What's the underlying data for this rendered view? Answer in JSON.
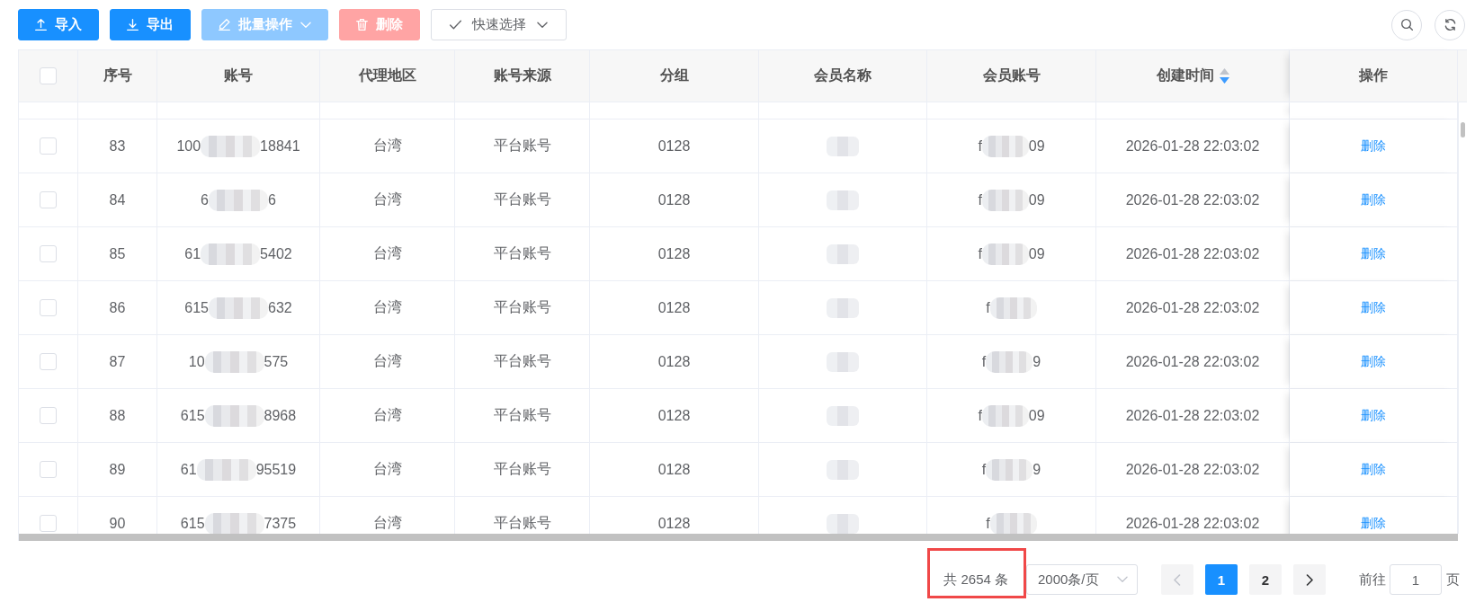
{
  "toolbar": {
    "buttons": [
      {
        "label": "导入",
        "kind": "import",
        "disabled": false,
        "dropdown": false
      },
      {
        "label": "导出",
        "kind": "export",
        "disabled": false,
        "dropdown": false
      },
      {
        "label": "批量操作",
        "kind": "batch",
        "disabled": true,
        "dropdown": true
      },
      {
        "label": "删除",
        "kind": "delete",
        "disabled": true,
        "dropdown": false
      },
      {
        "label": "快速选择",
        "kind": "quick_select",
        "disabled": false,
        "dropdown": true
      }
    ],
    "tools": [
      {
        "kind": "search"
      },
      {
        "kind": "refresh"
      }
    ]
  },
  "table": {
    "select_all": {
      "checked": false
    },
    "columns": [
      {
        "label": "序号"
      },
      {
        "label": "账号"
      },
      {
        "label": "代理地区"
      },
      {
        "label": "账号来源"
      },
      {
        "label": "分组"
      },
      {
        "label": "会员名称"
      },
      {
        "label": "会员账号"
      },
      {
        "label": "创建时间",
        "sort_descending": true
      },
      {
        "label": "操作"
      }
    ],
    "rows": [
      {
        "checked": false,
        "index": "83",
        "account": {
          "prefix": "100",
          "suffix": "18841"
        },
        "region": "台湾",
        "source": "平台账号",
        "group": "0128",
        "member_name": {
          "blurred": true
        },
        "member_account": {
          "prefix": "f",
          "suffix": "09"
        },
        "created": "2026-01-28 22:03:02",
        "action": "删除"
      },
      {
        "checked": false,
        "index": "84",
        "account": {
          "prefix": "6",
          "suffix": "6"
        },
        "region": "台湾",
        "source": "平台账号",
        "group": "0128",
        "member_name": {
          "blurred": true
        },
        "member_account": {
          "prefix": "f",
          "suffix": "09"
        },
        "created": "2026-01-28 22:03:02",
        "action": "删除"
      },
      {
        "checked": false,
        "index": "85",
        "account": {
          "prefix": "61",
          "suffix": "5402"
        },
        "region": "台湾",
        "source": "平台账号",
        "group": "0128",
        "member_name": {
          "blurred": true
        },
        "member_account": {
          "prefix": "f",
          "suffix": "09"
        },
        "created": "2026-01-28 22:03:02",
        "action": "删除"
      },
      {
        "checked": false,
        "index": "86",
        "account": {
          "prefix": "615",
          "suffix": "632"
        },
        "region": "台湾",
        "source": "平台账号",
        "group": "0128",
        "member_name": {
          "blurred": true
        },
        "member_account": {
          "prefix": "f"
        },
        "created": "2026-01-28 22:03:02",
        "action": "删除"
      },
      {
        "checked": false,
        "index": "87",
        "account": {
          "prefix": "10",
          "suffix": "575"
        },
        "region": "台湾",
        "source": "平台账号",
        "group": "0128",
        "member_name": {
          "blurred": true
        },
        "member_account": {
          "prefix": "f",
          "suffix": "9"
        },
        "created": "2026-01-28 22:03:02",
        "action": "删除"
      },
      {
        "checked": false,
        "index": "88",
        "account": {
          "prefix": "615",
          "suffix": "8968"
        },
        "region": "台湾",
        "source": "平台账号",
        "group": "0128",
        "member_name": {
          "blurred": true
        },
        "member_account": {
          "prefix": "f",
          "suffix": "09"
        },
        "created": "2026-01-28 22:03:02",
        "action": "删除"
      },
      {
        "checked": false,
        "index": "89",
        "account": {
          "prefix": "61",
          "suffix": "95519"
        },
        "region": "台湾",
        "source": "平台账号",
        "group": "0128",
        "member_name": {
          "blurred": true
        },
        "member_account": {
          "prefix": "f",
          "suffix": "9"
        },
        "created": "2026-01-28 22:03:02",
        "action": "删除"
      },
      {
        "checked": false,
        "index": "90",
        "account": {
          "prefix": "615",
          "suffix": "7375"
        },
        "region": "台湾",
        "source": "平台账号",
        "group": "0128",
        "member_name": {
          "blurred": true
        },
        "member_account": {
          "prefix": "f"
        },
        "created": "2026-01-28 22:03:02",
        "action": "删除"
      }
    ]
  },
  "pagination": {
    "total": "共 2654 条",
    "total_highlighted": true,
    "page_size": "2000条/页",
    "prev_disabled": true,
    "pages": [
      {
        "label": "1",
        "selected": true
      },
      {
        "label": "2",
        "selected": false
      }
    ],
    "next_disabled": false,
    "jumper_label": "前往",
    "jumper_value": "1",
    "jumper_suffix": "页"
  }
}
